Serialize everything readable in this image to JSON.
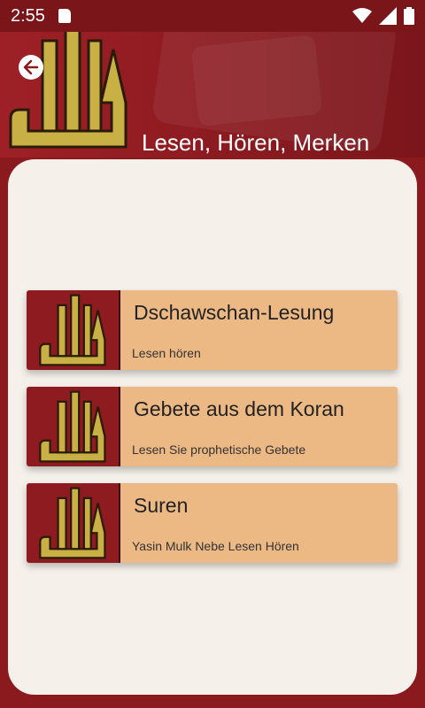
{
  "status_bar": {
    "time": "2:55"
  },
  "header": {
    "title": "Lesen, Hören, Merken"
  },
  "cards": [
    {
      "title": "Dschawschan-Lesung",
      "subtitle": "Lesen hören"
    },
    {
      "title": "Gebete aus dem Koran",
      "subtitle": "Lesen Sie prophetische Gebete"
    },
    {
      "title": "Suren",
      "subtitle": "Yasin Mulk Nebe Lesen Hören"
    }
  ],
  "colors": {
    "primary": "#8b1a1f",
    "card": "#ecb985",
    "content_bg": "#f5f0ea",
    "logo_gold": "#c8b045"
  }
}
